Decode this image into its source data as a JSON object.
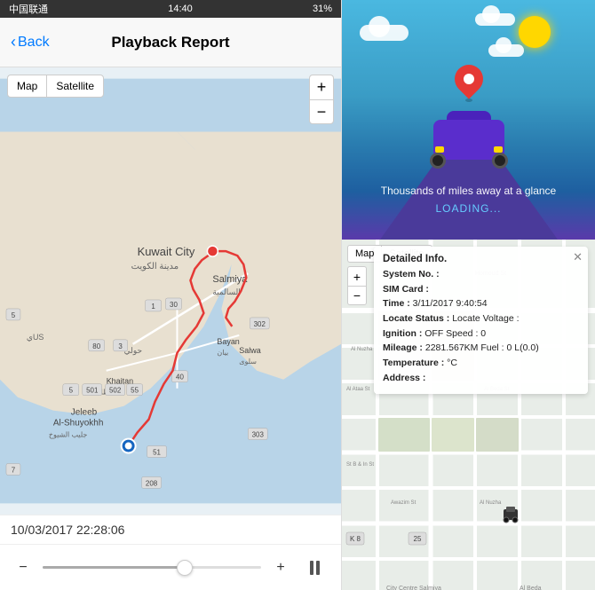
{
  "status_bar": {
    "signal": "●●●●○",
    "carrier": "中国联通",
    "time": "14:40",
    "battery": "31%"
  },
  "header": {
    "back_label": "Back",
    "title": "Playback Report"
  },
  "map": {
    "type_map": "Map",
    "type_satellite": "Satellite",
    "zoom_in": "+",
    "zoom_out": "−",
    "zoom_in2": "+",
    "zoom_out2": "−"
  },
  "timestamp": "10/03/2017 22:28:06",
  "controls": {
    "minus": "−",
    "plus": "+"
  },
  "illustration": {
    "tagline": "Thousands of miles away at a glance",
    "loading": "LOADING..."
  },
  "detail_info": {
    "title": "Detailed Info.",
    "system_no_label": "System No. :",
    "system_no_value": "",
    "sim_card_label": "SIM Card :",
    "sim_card_value": "",
    "time_label": "Time :",
    "time_value": "3/11/2017 9:40:54",
    "locate_status_label": "Locate Status :",
    "locate_status_value": "Locate Voltage :",
    "ignition_label": "Ignition :",
    "ignition_value": "OFF Speed : 0",
    "mileage_label": "Mileage :",
    "mileage_value": "2281.567KM Fuel : 0 L(0.0)",
    "temperature_label": "Temperature :",
    "temperature_value": "°C",
    "address_label": "Address :",
    "address_value": ""
  }
}
